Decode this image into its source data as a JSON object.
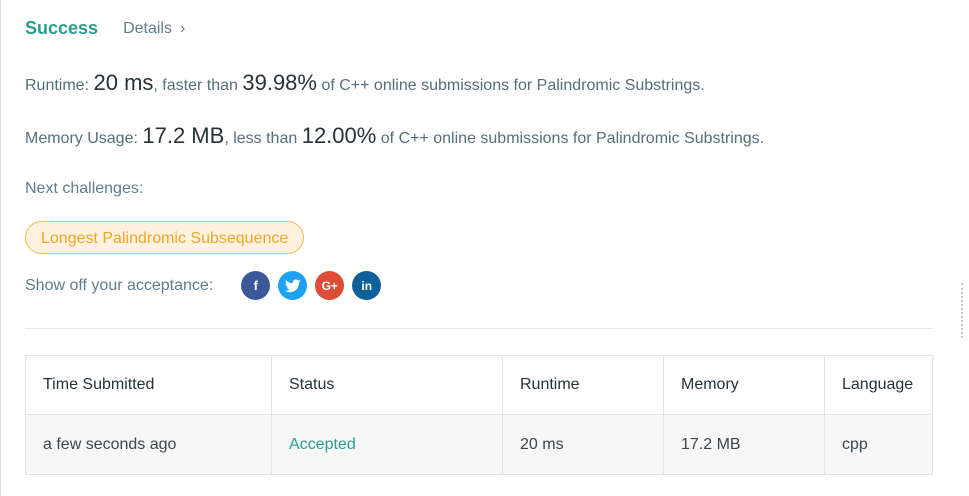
{
  "header": {
    "status": "Success",
    "details_label": "Details",
    "details_chevron": "›"
  },
  "runtime": {
    "label": "Runtime:",
    "value": "20 ms",
    "comparison": ", faster than",
    "percent": "39.98%",
    "suffix": "of C++ online submissions for Palindromic Substrings."
  },
  "memory": {
    "label": "Memory Usage:",
    "value": "17.2 MB",
    "comparison": ", less than",
    "percent": "12.00%",
    "suffix": "of C++ online submissions for Palindromic Substrings."
  },
  "next_challenges": {
    "label": "Next challenges:",
    "items": [
      "Longest Palindromic Subsequence"
    ]
  },
  "share": {
    "label": "Show off your acceptance:",
    "icons": [
      {
        "name": "facebook-icon",
        "glyph": "f",
        "color": "#3b5998"
      },
      {
        "name": "twitter-icon",
        "glyph": "t",
        "color": "#1da1f2"
      },
      {
        "name": "google-plus-icon",
        "glyph": "G+",
        "color": "#dd4b39"
      },
      {
        "name": "linkedin-icon",
        "glyph": "in",
        "color": "#0e6198"
      }
    ]
  },
  "table": {
    "columns": [
      "Time Submitted",
      "Status",
      "Runtime",
      "Memory",
      "Language"
    ],
    "rows": [
      [
        "a few seconds ago",
        "Accepted",
        "20 ms",
        "17.2 MB",
        "cpp"
      ]
    ]
  },
  "colors": {
    "success": "#2a9d8f",
    "challenge_border": "#f5b955",
    "challenge_bg": "#fff3df",
    "challenge_text": "#f0a42c"
  }
}
